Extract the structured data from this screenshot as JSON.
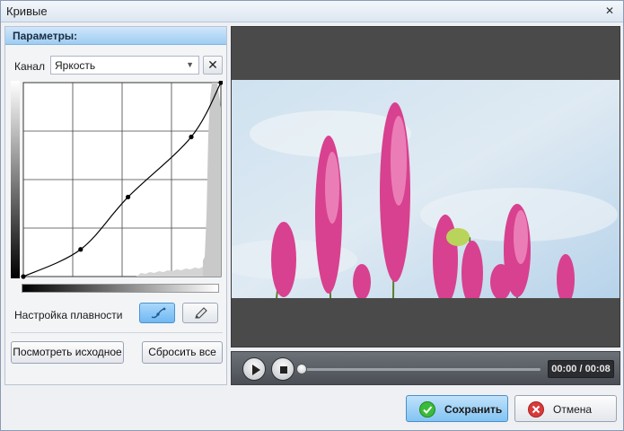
{
  "window": {
    "title": "Кривые"
  },
  "panel": {
    "header": "Параметры:"
  },
  "channel": {
    "label": "Канал",
    "value": "Яркость"
  },
  "smoothing": {
    "label": "Настройка плавности"
  },
  "buttons": {
    "view_original": "Посмотреть исходное",
    "reset_all": "Сбросить все",
    "save": "Сохранить",
    "cancel": "Отмена"
  },
  "player": {
    "time": "00:00 / 00:08",
    "progress": 0
  },
  "curve": {
    "points": [
      [
        0,
        0
      ],
      [
        0.29,
        0.14
      ],
      [
        0.53,
        0.41
      ],
      [
        0.85,
        0.72
      ],
      [
        1.0,
        1.0
      ]
    ],
    "grid_divisions": 4
  },
  "icons": {
    "close": "close-icon",
    "reset_channel": "x-icon",
    "curve_tool": "curve-tool-icon",
    "pencil_tool": "pencil-icon",
    "play": "play-icon",
    "stop": "stop-icon",
    "save": "check-icon",
    "cancel": "cancel-x-icon"
  },
  "colors": {
    "accent": "#7fc0f2",
    "save_check": "#3bbb3b",
    "cancel_red": "#d93a3a"
  }
}
